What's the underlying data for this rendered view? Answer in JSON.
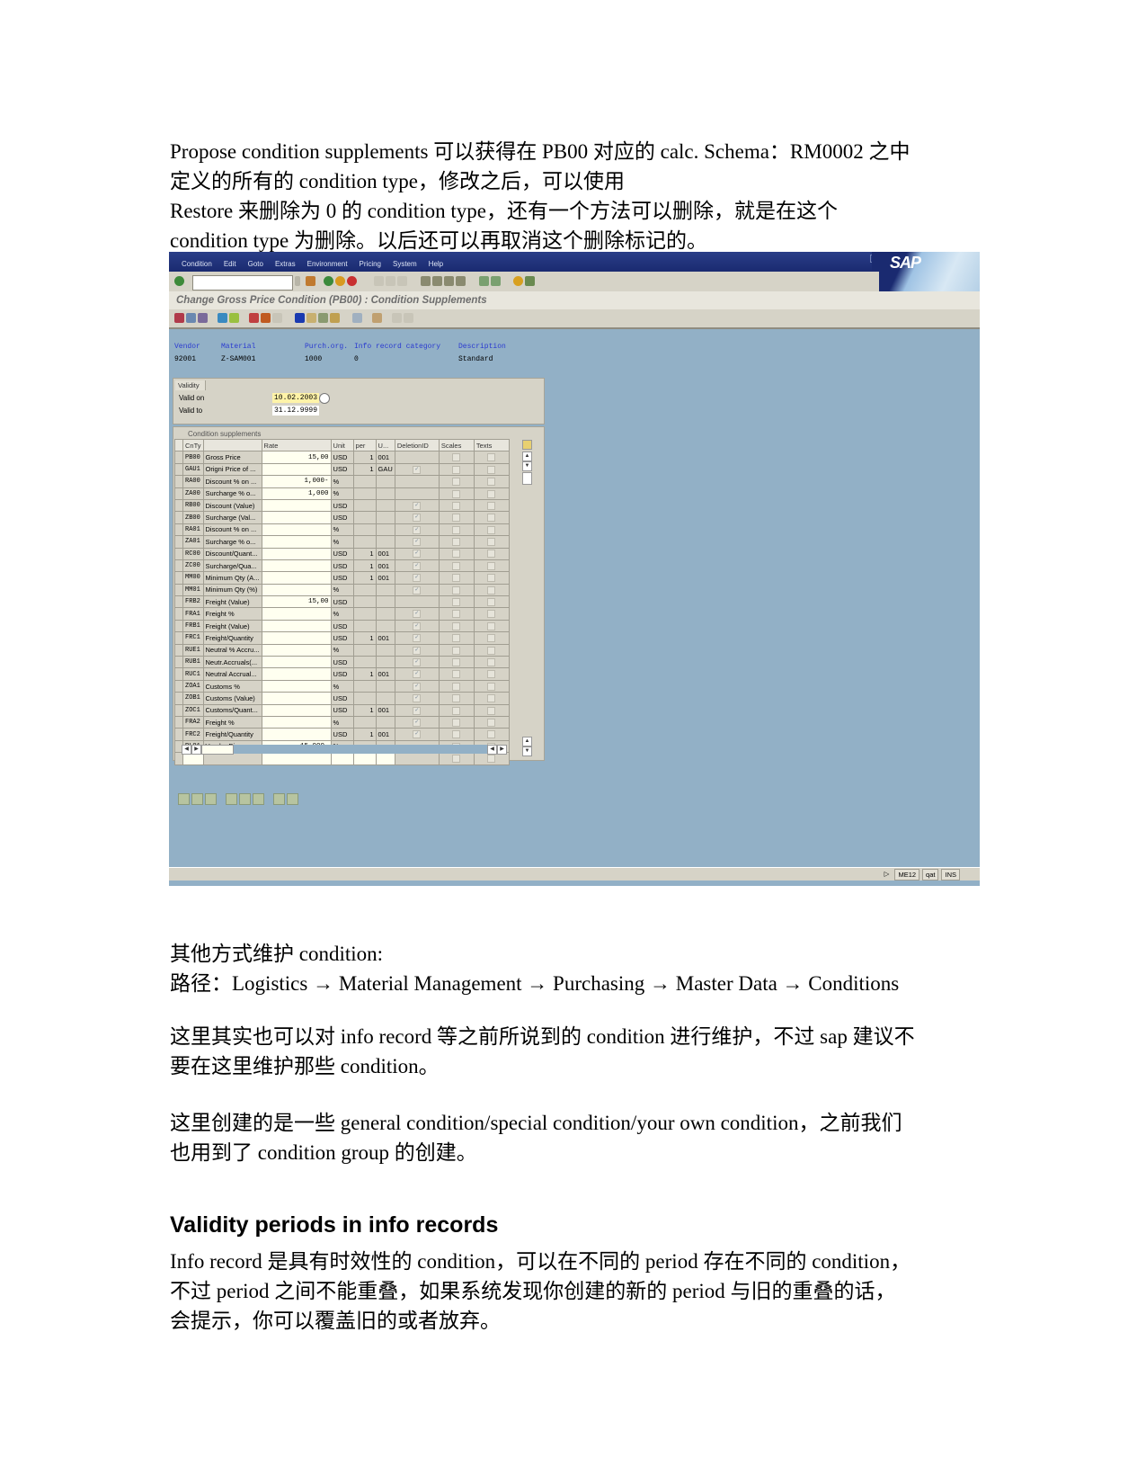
{
  "intro": {
    "lines": [
      "Propose condition supplements 可以获得在 PB00 对应的 calc. Schema：RM0002 之中",
      "定义的所有的 condition type，修改之后，可以使用",
      "Restore 来删除为 0 的 condition type，还有一个方法可以删除，就是在这个",
      "condition type 为删除。以后还可以再取消这个删除标记的。"
    ]
  },
  "sap": {
    "menu": [
      "Condition",
      "Edit",
      "Goto",
      "Extras",
      "Environment",
      "Pricing",
      "System",
      "Help"
    ],
    "logo": "SAP",
    "command_field": "",
    "screen_title": "Change Gross Price Condition (PB00) : Condition Supplements",
    "header": {
      "labels": {
        "vendor": "Vendor",
        "material": "Material",
        "purch_org": "Purch.org.",
        "info_cat": "Info record category",
        "description": "Description"
      },
      "values": {
        "vendor": "92001",
        "material": "Z-SAM001",
        "purch_org": "1000",
        "info_cat": "0",
        "description": "Standard"
      }
    },
    "validity": {
      "tab": "Validity",
      "valid_on_label": "Valid on",
      "valid_on": "10.02.2003",
      "valid_to_label": "Valid to",
      "valid_to": "31.12.9999"
    },
    "supplements": {
      "tab": "Condition supplements",
      "columns": [
        "CnTy",
        "",
        "Rate",
        "Unit",
        "per",
        "U...",
        "DeletionID",
        "Scales",
        "Texts"
      ],
      "rows": [
        {
          "cnty": "PB00",
          "desc": "Gross Price",
          "rate": "15,00",
          "unit": "USD",
          "per": "1",
          "uom": "001",
          "del": false
        },
        {
          "cnty": "GAU1",
          "desc": "Origni Price of ...",
          "rate": "",
          "unit": "USD",
          "per": "1",
          "uom": "GAU",
          "del": true
        },
        {
          "cnty": "RA00",
          "desc": "Discount % on ...",
          "rate": "1,000-",
          "unit": "%",
          "per": "",
          "uom": "",
          "del": false
        },
        {
          "cnty": "ZA00",
          "desc": "Surcharge % o...",
          "rate": "1,000",
          "unit": "%",
          "per": "",
          "uom": "",
          "del": false
        },
        {
          "cnty": "RB00",
          "desc": "Discount (Value)",
          "rate": "",
          "unit": "USD",
          "per": "",
          "uom": "",
          "del": true
        },
        {
          "cnty": "ZB00",
          "desc": "Surcharge (Val...",
          "rate": "",
          "unit": "USD",
          "per": "",
          "uom": "",
          "del": true
        },
        {
          "cnty": "RA01",
          "desc": "Discount % on ...",
          "rate": "",
          "unit": "%",
          "per": "",
          "uom": "",
          "del": true
        },
        {
          "cnty": "ZA01",
          "desc": "Surcharge % o...",
          "rate": "",
          "unit": "%",
          "per": "",
          "uom": "",
          "del": true
        },
        {
          "cnty": "RC00",
          "desc": "Discount/Quant...",
          "rate": "",
          "unit": "USD",
          "per": "1",
          "uom": "001",
          "del": true
        },
        {
          "cnty": "ZC00",
          "desc": "Surcharge/Qua...",
          "rate": "",
          "unit": "USD",
          "per": "1",
          "uom": "001",
          "del": true
        },
        {
          "cnty": "MM00",
          "desc": "Minimum Qty (A...",
          "rate": "",
          "unit": "USD",
          "per": "1",
          "uom": "001",
          "del": true
        },
        {
          "cnty": "MM01",
          "desc": "Minimum Qty (%)",
          "rate": "",
          "unit": "%",
          "per": "",
          "uom": "",
          "del": true
        },
        {
          "cnty": "FRB2",
          "desc": "Freight (Value)",
          "rate": "15,00",
          "unit": "USD",
          "per": "",
          "uom": "",
          "del": false
        },
        {
          "cnty": "FRA1",
          "desc": "Freight %",
          "rate": "",
          "unit": "%",
          "per": "",
          "uom": "",
          "del": true
        },
        {
          "cnty": "FRB1",
          "desc": "Freight (Value)",
          "rate": "",
          "unit": "USD",
          "per": "",
          "uom": "",
          "del": true
        },
        {
          "cnty": "FRC1",
          "desc": "Freight/Quantity",
          "rate": "",
          "unit": "USD",
          "per": "1",
          "uom": "001",
          "del": true
        },
        {
          "cnty": "RUE1",
          "desc": "Neutral % Accru...",
          "rate": "",
          "unit": "%",
          "per": "",
          "uom": "",
          "del": true
        },
        {
          "cnty": "RUB1",
          "desc": "Neutr.Accruals(...",
          "rate": "",
          "unit": "USD",
          "per": "",
          "uom": "",
          "del": true
        },
        {
          "cnty": "RUC1",
          "desc": "Neutral Accrual...",
          "rate": "",
          "unit": "USD",
          "per": "1",
          "uom": "001",
          "del": true
        },
        {
          "cnty": "ZOA1",
          "desc": "Customs %",
          "rate": "",
          "unit": "%",
          "per": "",
          "uom": "",
          "del": true
        },
        {
          "cnty": "ZOB1",
          "desc": "Customs (Value)",
          "rate": "",
          "unit": "USD",
          "per": "",
          "uom": "",
          "del": true
        },
        {
          "cnty": "ZOC1",
          "desc": "Customs/Quant...",
          "rate": "",
          "unit": "USD",
          "per": "1",
          "uom": "001",
          "del": true
        },
        {
          "cnty": "FRA2",
          "desc": "Freight %",
          "rate": "",
          "unit": "%",
          "per": "",
          "uom": "",
          "del": true
        },
        {
          "cnty": "FRC2",
          "desc": "Freight/Quantity",
          "rate": "",
          "unit": "USD",
          "per": "1",
          "uom": "001",
          "del": true
        },
        {
          "cnty": "RL01",
          "desc": "Vendor Discou...",
          "rate": "15,000-",
          "unit": "%",
          "per": "",
          "uom": "",
          "del": false
        },
        {
          "cnty": "",
          "desc": "",
          "rate": "",
          "unit": "",
          "per": "",
          "uom": "",
          "del": false
        }
      ]
    },
    "status": {
      "transaction": "ME12",
      "server": "qat",
      "mode": "INS"
    }
  },
  "section2": {
    "lines": [
      "其他方式维护 condition:",
      "路径：Logistics → Material Management → Purchasing → Master Data → Conditions"
    ]
  },
  "section3": {
    "lines": [
      "这里其实也可以对 info record 等之前所说到的 condition 进行维护，不过 sap 建议不",
      "要在这里维护那些 condition。"
    ]
  },
  "section4": {
    "lines": [
      "这里创建的是一些 general condition/special condition/your own condition，之前我们",
      "也用到了 condition group 的创建。"
    ]
  },
  "heading": "Validity periods in info records",
  "section5": {
    "lines": [
      "Info record 是具有时效性的 condition，可以在不同的 period 存在不同的 condition，",
      "不过 period 之间不能重叠，如果系统发现你创建的新的 period 与旧的重叠的话，",
      "会提示，你可以覆盖旧的或者放弃。"
    ]
  }
}
